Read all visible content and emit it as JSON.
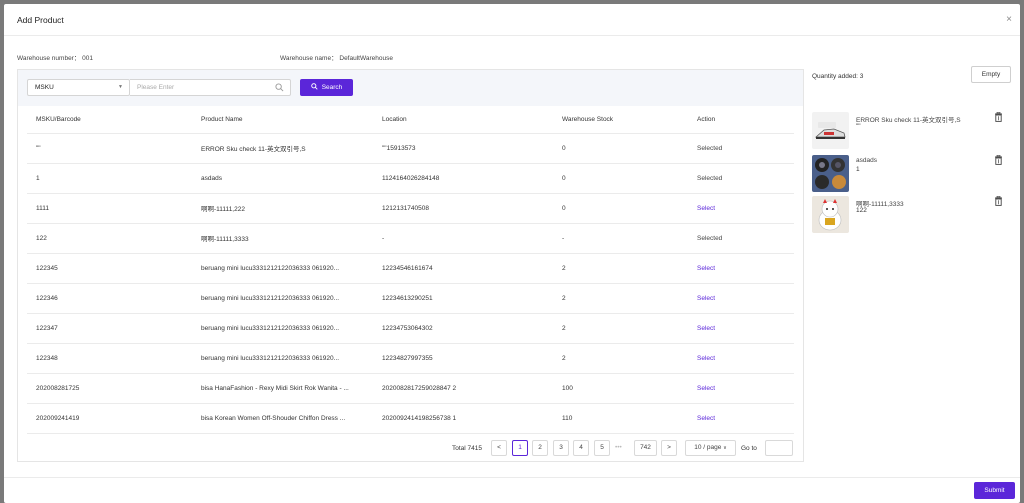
{
  "dialog": {
    "title": "Add Product",
    "close_glyph": "×"
  },
  "info": {
    "warehouse_number": "Warehouse number： 001",
    "warehouse_name": "Warehouse name： DefaultWarehouse"
  },
  "search": {
    "field": "MSKU",
    "placeholder": "Please Enter",
    "button": "Search"
  },
  "table": {
    "headers": [
      "MSKU/Barcode",
      "Product Name",
      "Location",
      "Warehouse Stock",
      "Action"
    ],
    "rows": [
      [
        "\"\"",
        "ERROR Sku check 11-英文双引号,S",
        "\"\"15913573",
        "0",
        "Selected"
      ],
      [
        "1",
        "asdads",
        "1124164026284148",
        "0",
        "Selected"
      ],
      [
        "1111",
        "啊啊-11111,222",
        "1212131740508",
        "0",
        "Select"
      ],
      [
        "122",
        "啊啊-11111,3333",
        "-",
        "-",
        "Selected"
      ],
      [
        "122345",
        "beruang mini lucu3331212122036333 061920...",
        "12234546161674",
        "2",
        "Select"
      ],
      [
        "122346",
        "beruang mini lucu3331212122036333 061920...",
        "12234613290251",
        "2",
        "Select"
      ],
      [
        "122347",
        "beruang mini lucu3331212122036333 061920...",
        "12234753064302",
        "2",
        "Select"
      ],
      [
        "122348",
        "beruang mini lucu3331212122036333 061920...",
        "12234827997355",
        "2",
        "Select"
      ],
      [
        "202008281725",
        "bisa HanaFashion - Rexy Midi Skirt Rok Wanita - ...",
        "2020082817259028847 2",
        "100",
        "Select"
      ],
      [
        "202009241419",
        "bisa Korean Women Off-Shouder Chiffon Dress ...",
        "2020092414198256738 1",
        "110",
        "Select"
      ]
    ]
  },
  "pagination": {
    "total": "Total 7415",
    "prev": "<",
    "pages": [
      "1",
      "2",
      "3",
      "4",
      "5"
    ],
    "ellipsis": "•••",
    "last": "742",
    "next": ">",
    "page_size": "10 / page",
    "goto": "Go to"
  },
  "selected": {
    "quantity": "Quantity added: 3",
    "empty_button": "Empty",
    "items": [
      {
        "name": "ERROR Sku check 11-英文双引号,S",
        "sub": "\"\""
      },
      {
        "name": "asdads",
        "sub": "1"
      },
      {
        "name": "啊啊-11111,3333",
        "sub": "122"
      }
    ]
  },
  "footer": {
    "submit": "Submit"
  },
  "colors": {
    "accent": "#5b26d9",
    "toolbar_bg": "#f4f6fa",
    "border": "#ebebeb"
  }
}
